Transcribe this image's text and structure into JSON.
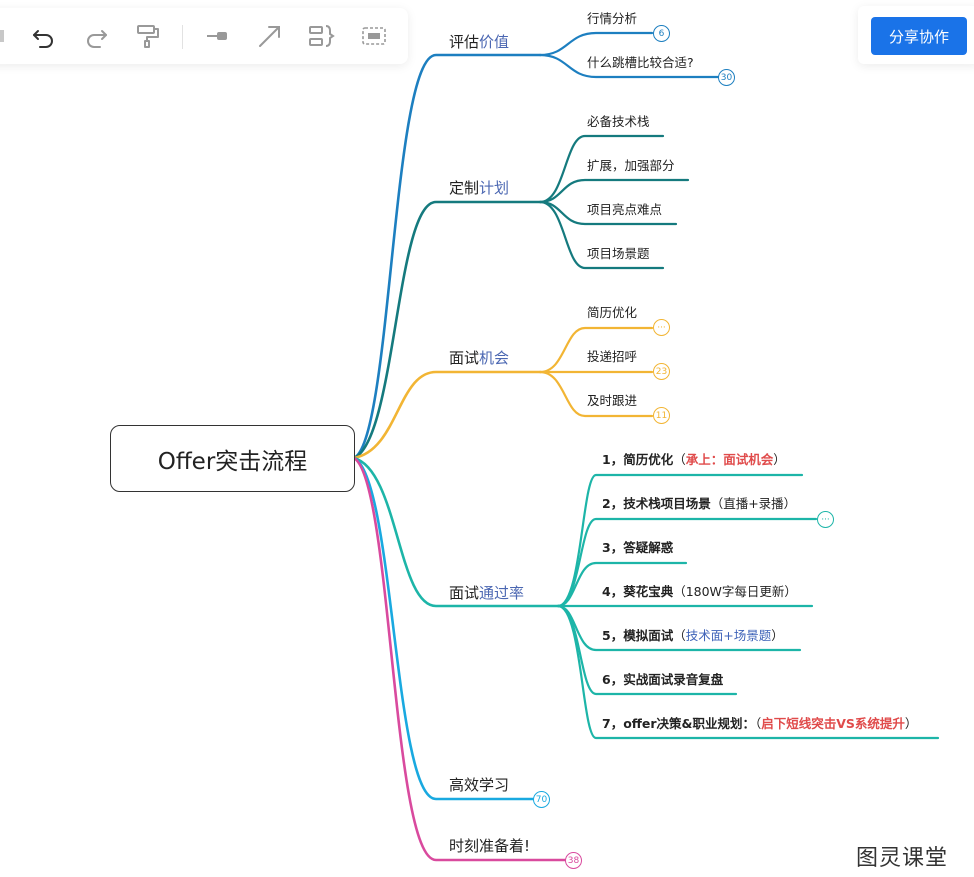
{
  "toolbar": {
    "undo_icon": "undo-icon",
    "redo_icon": "redo-icon",
    "format_painter_icon": "format-painter-icon",
    "connector_icon": "connector-icon",
    "arrow_icon": "arrow-icon",
    "summary_icon": "summary-icon",
    "boundary_icon": "boundary-icon"
  },
  "share_button": "分享协作",
  "root": "Offer突击流程",
  "colors": {
    "branch1": "#1d7fc0",
    "branch2": "#157a7e",
    "branch3": "#f2b534",
    "branch4": "#1db5a8",
    "branch5": "#19a9e0",
    "branch6": "#d94a9e",
    "accent": "#1a73e8"
  },
  "branches": [
    {
      "label_plain": "评估",
      "label_hl": "价值",
      "children": [
        {
          "text": "行情分析",
          "badge": "6"
        },
        {
          "text": "什么跳槽比较合适?",
          "badge": "30"
        }
      ]
    },
    {
      "label_plain": "定制",
      "label_hl": "计划",
      "children": [
        {
          "text": "必备技术栈"
        },
        {
          "text": "扩展，加强部分"
        },
        {
          "text": "项目亮点难点"
        },
        {
          "text": "项目场景题"
        }
      ]
    },
    {
      "label_plain": "面试",
      "label_hl": "机会",
      "children": [
        {
          "text": "简历优化",
          "badge": "···"
        },
        {
          "text": "投递招呼",
          "badge": "23"
        },
        {
          "text": "及时跟进",
          "badge": "11"
        }
      ]
    },
    {
      "label_plain": "面试",
      "label_hl": "通过率",
      "children": [
        {
          "bold": "1，简历优化",
          "open": "（",
          "note": "承上：面试机会",
          "close": "）"
        },
        {
          "bold": "2，技术栈项目场景",
          "plain": "（直播+录播）",
          "badge": "···"
        },
        {
          "bold": "3，答疑解惑"
        },
        {
          "bold": "4，葵花宝典",
          "plain": "（180W字每日更新）"
        },
        {
          "bold": "5，模拟面试",
          "open": "（",
          "note": "技术面+场景题",
          "close": "）"
        },
        {
          "bold": "6，实战面试录音复盘"
        },
        {
          "bold": "7，offer决策&职业规划：",
          "open": "（",
          "note": "启下短线突击VS系统提升",
          "close": "）"
        }
      ]
    },
    {
      "label": "高效学习",
      "badge": "70"
    },
    {
      "label": "时刻准备着!",
      "badge": "38"
    }
  ],
  "watermark": "图灵课堂"
}
